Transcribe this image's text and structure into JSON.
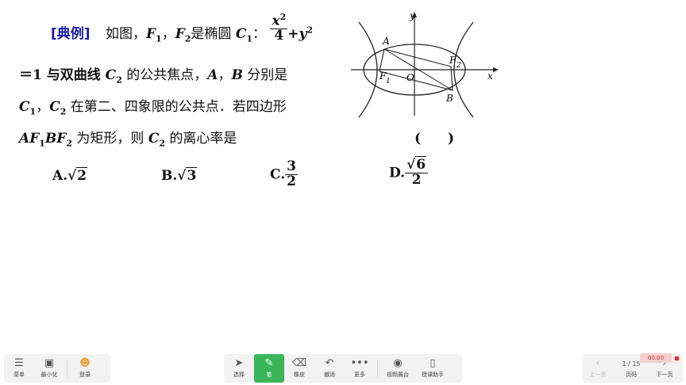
{
  "problem": {
    "tag": "[典例]",
    "line1_a": "如图，",
    "F1": "F",
    "sub1": "1",
    "comma": "，",
    "F2": "F",
    "sub2": "2",
    "line1_b": "是椭圆 ",
    "C1": "C",
    "line1_c": "：",
    "frac_num": "x",
    "frac_den": "4",
    "plus": "+",
    "y": "y",
    "sq": "2",
    "line2_a": "＝1 与双曲线 ",
    "C2": "C",
    "line2_b": " 的公共焦点，",
    "A": "A",
    "line2_c": "，",
    "B": "B",
    "line2_d": " 分别是",
    "line3_a": "C",
    "line3_b": "，",
    "line3_c": "C",
    "line3_d": " 在第二、四象限的公共点．若四边形",
    "line4_a": "AF",
    "line4_b": "BF",
    "line4_c": " 为矩形，则 ",
    "line4_d": "C",
    "line4_e": " 的离心率是",
    "paren": "(　　)",
    "optA_label": "A.",
    "optA_rad": "2",
    "optB_label": "B.",
    "optB_rad": "3",
    "optC_label": "C.",
    "optC_num": "3",
    "optC_den": "2",
    "optD_label": "D.",
    "optD_rad": "6",
    "optD_den": "2"
  },
  "figure": {
    "y_label": "y",
    "x_label": "x",
    "o_label": "O",
    "a_label": "A",
    "b_label": "B",
    "f1_label": "F",
    "f1_sub": "1",
    "f2_label": "F",
    "f2_sub": "2"
  },
  "toolbar": {
    "menu": "菜单",
    "minimize": "最小化",
    "login": "登录",
    "select": "选择",
    "pen": "笔",
    "eraser": "橡皮",
    "undo": "撤消",
    "more": "更多",
    "video": "视频展台",
    "assistant": "授课助手",
    "prev": "上一页",
    "page_num": "1 / 15",
    "page_label": "页码",
    "next": "下一页",
    "timer": "00:00"
  }
}
